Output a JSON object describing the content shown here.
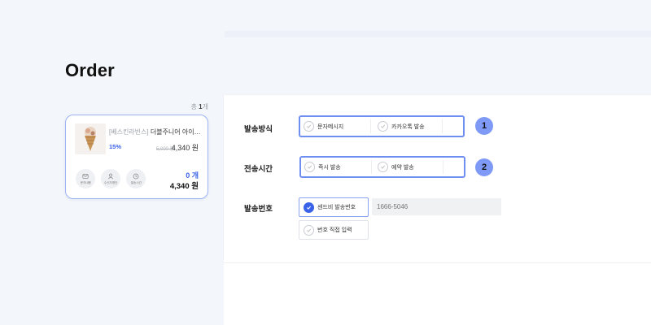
{
  "page": {
    "title": "Order"
  },
  "cart": {
    "total_prefix": "총 ",
    "total_count": "1",
    "total_suffix": "개",
    "item": {
      "brand": "[베스킨라빈스]",
      "name": "더블주니어 아이스...",
      "discount": "15%",
      "original_price": "5,000 원",
      "price": "4,340 원",
      "quantity": "0 개",
      "total": "4,340 원",
      "actions": [
        {
          "label": "문자내용",
          "icon": "message-icon"
        },
        {
          "label": "수신자명단",
          "icon": "person-icon"
        },
        {
          "label": "발송시간",
          "icon": "clock-icon"
        }
      ]
    }
  },
  "form": {
    "send_method": {
      "label": "발송방식",
      "options": [
        "문자메시지",
        "카카오톡 발송"
      ],
      "badge": "1"
    },
    "send_time": {
      "label": "전송시간",
      "options": [
        "즉시 발송",
        "예약 발송"
      ],
      "badge": "2"
    },
    "sender_number": {
      "label": "발송번호",
      "options": [
        "센드비 발송번호",
        "번호 직접 입력"
      ],
      "selected": "센드비 발송번호",
      "phone_placeholder": "1666-5046"
    }
  },
  "colors": {
    "accent": "#3a62e8",
    "badge": "#7f9af6",
    "highlight_border": "#6f8ef2"
  }
}
